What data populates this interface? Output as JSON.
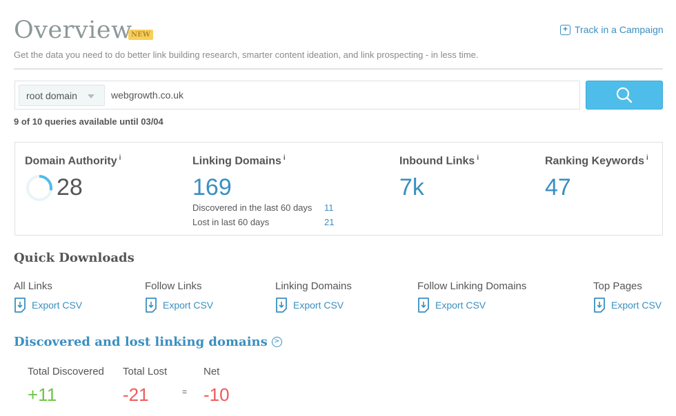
{
  "header": {
    "title": "Overview",
    "badge": "NEW",
    "track_label": "Track in a Campaign",
    "subtitle": "Get the data you need to do better link building research, smarter content ideation, and link prospecting - in less time."
  },
  "search": {
    "scope": "root domain",
    "value": "webgrowth.co.uk",
    "button_icon": "search-icon",
    "queries": "9 of 10 queries available until 03/04"
  },
  "metrics": {
    "domain_authority": {
      "label": "Domain Authority",
      "info": "i",
      "value": "28",
      "score": 28
    },
    "linking_domains": {
      "label": "Linking Domains",
      "info": "i",
      "value": "169",
      "discovered_label": "Discovered in the last 60 days",
      "discovered": "11",
      "lost_label": "Lost in last 60 days",
      "lost": "21"
    },
    "inbound_links": {
      "label": "Inbound Links",
      "info": "i",
      "value": "7k"
    },
    "ranking_keywords": {
      "label": "Ranking Keywords",
      "info": "i",
      "value": "47"
    }
  },
  "quick_downloads": {
    "title": "Quick Downloads",
    "items": [
      {
        "label": "All Links",
        "action": "Export CSV"
      },
      {
        "label": "Follow Links",
        "action": "Export CSV"
      },
      {
        "label": "Linking Domains",
        "action": "Export CSV"
      },
      {
        "label": "Follow Linking Domains",
        "action": "Export CSV"
      },
      {
        "label": "Top Pages",
        "action": "Export CSV"
      }
    ]
  },
  "discovered_lost": {
    "title": "Discovered and lost linking domains",
    "total_discovered_label": "Total Discovered",
    "total_discovered": "+11",
    "total_lost_label": "Total Lost",
    "total_lost": "-21",
    "equals": "=",
    "net_label": "Net",
    "net": "-10"
  },
  "colors": {
    "accent": "#3a8fc0",
    "button": "#4fbde9",
    "positive": "#6cc644",
    "negative": "#f05a5a",
    "badge": "#f9cf5b"
  }
}
